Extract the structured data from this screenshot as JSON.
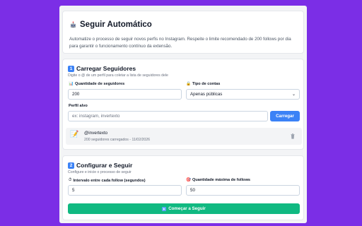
{
  "header": {
    "icon": "robot-icon",
    "title": "Seguir Automático",
    "description": "Automatize o processo de seguir novos perfis no Instagram. Respeite o limite recomendado de 200 follows por dia para garantir o funcionamento contínuo da extensão."
  },
  "load": {
    "number": "1",
    "title": "Carregar Seguidores",
    "subtitle": "Digite o @ de um perfil para coletar a lista de seguidores dele",
    "quantity_label": "Quantidade de seguidores",
    "quantity_value": "200",
    "type_label": "Tipo de contas",
    "type_value": "Apenas públicas",
    "profile_label": "Perfil alvo",
    "profile_placeholder": "ex: instagram, invertexto",
    "load_button": "Carregar",
    "loaded_profile": {
      "handle": "@invertexto",
      "meta": "200 seguidores carregados - 11/02/2026"
    }
  },
  "configure": {
    "number": "2",
    "title": "Configurar e Seguir",
    "subtitle": "Configure e inicie o processo de seguir",
    "interval_label": "Intervalo entre cada follow (segundos)",
    "interval_value": "5",
    "max_label": "Quantidade máxima de follows",
    "max_value": "50",
    "start_button": "Começar a Seguir"
  },
  "colors": {
    "background": "#7b2ee6",
    "primary": "#3b82f6",
    "success": "#10b981"
  }
}
